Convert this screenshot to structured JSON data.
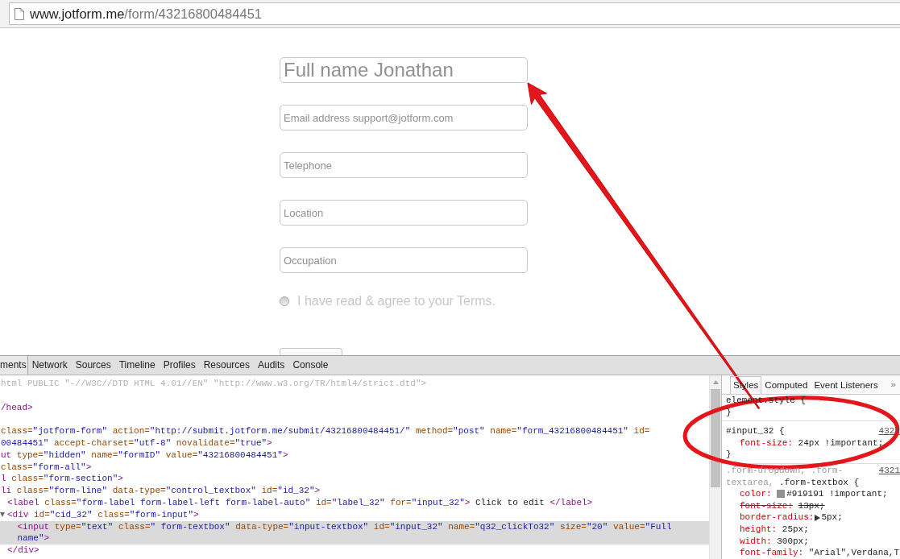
{
  "address_bar": {
    "host": "www.jotform.me",
    "path": "/form/43216800484451"
  },
  "form": {
    "fields": [
      {
        "kind": "large",
        "value": "Full name Jonathan"
      },
      {
        "kind": "normal",
        "value": "Email address support@jotform.com"
      },
      {
        "kind": "normal",
        "value": "Telephone"
      },
      {
        "kind": "normal",
        "value": "Location"
      },
      {
        "kind": "normal",
        "value": "Occupation"
      }
    ],
    "terms": {
      "label": "I have read & agree to your Terms.",
      "checked": false
    }
  },
  "devtools": {
    "tabs": [
      {
        "label": "ments",
        "selected": true
      },
      {
        "label": "Network",
        "selected": false
      },
      {
        "label": "Sources",
        "selected": false
      },
      {
        "label": "Timeline",
        "selected": false
      },
      {
        "label": "Profiles",
        "selected": false
      },
      {
        "label": "Resources",
        "selected": false
      },
      {
        "label": "Audits",
        "selected": false
      },
      {
        "label": "Console",
        "selected": false
      }
    ]
  },
  "elements": {
    "tree": [
      {
        "lines": [
          [
            {
              "kind": "doctype",
              "text": "html PUBLIC \"-//W3C//DTD HTML 4.01//EN\" \"http://www.w3.org/TR/html4/strict.dtd\">"
            }
          ]
        ],
        "selected": false
      },
      {
        "children": [
          {
            "lines": [
              [
                {
                  "kind": "tag",
                  "text": "/head>"
                }
              ]
            ],
            "selected": false
          },
          {
            "children": [
              {
                "lines": [
                  [
                    {
                      "kind": "attr",
                      "text": "class="
                    },
                    {
                      "kind": "value",
                      "text": "\"jotform-form\""
                    },
                    {
                      "kind": "attr",
                      "text": " action="
                    },
                    {
                      "kind": "value",
                      "text": "\"http://submit.jotform.me/submit/43216800484451/\""
                    },
                    {
                      "kind": "attr",
                      "text": " method="
                    },
                    {
                      "kind": "value",
                      "text": "\"post\""
                    },
                    {
                      "kind": "attr",
                      "text": " name="
                    },
                    {
                      "kind": "value",
                      "text": "\"form_43216800484451\""
                    },
                    {
                      "kind": "attr",
                      "text": " id="
                    }
                  ],
                  [
                    {
                      "kind": "value",
                      "text": "00484451\""
                    },
                    {
                      "kind": "attr",
                      "text": " accept-charset="
                    },
                    {
                      "kind": "value",
                      "text": "\"utf-8\""
                    },
                    {
                      "kind": "attr",
                      "text": " novalidate="
                    },
                    {
                      "kind": "value",
                      "text": "\"true\""
                    },
                    {
                      "kind": "tag",
                      "text": ">"
                    }
                  ]
                ],
                "selected": false,
                "children": [
                  {
                    "lines": [
                      [
                        {
                          "kind": "tag",
                          "text": "ut"
                        },
                        {
                          "kind": "attr",
                          "text": " type="
                        },
                        {
                          "kind": "value",
                          "text": "\"hidden\""
                        },
                        {
                          "kind": "attr",
                          "text": " name="
                        },
                        {
                          "kind": "value",
                          "text": "\"formID\""
                        },
                        {
                          "kind": "attr",
                          "text": " value="
                        },
                        {
                          "kind": "value",
                          "text": "\"43216800484451\""
                        },
                        {
                          "kind": "tag",
                          "text": ">"
                        }
                      ]
                    ],
                    "selected": false
                  },
                  {
                    "lines": [
                      [
                        {
                          "kind": "attr",
                          "text": "class="
                        },
                        {
                          "kind": "value",
                          "text": "\"form-all\""
                        },
                        {
                          "kind": "tag",
                          "text": ">"
                        }
                      ]
                    ],
                    "selected": false,
                    "children": [
                      {
                        "lines": [
                          [
                            {
                              "kind": "tag",
                              "text": "l"
                            },
                            {
                              "kind": "attr",
                              "text": " class="
                            },
                            {
                              "kind": "value",
                              "text": "\"form-section\""
                            },
                            {
                              "kind": "tag",
                              "text": ">"
                            }
                          ]
                        ],
                        "selected": false,
                        "children": [
                          {
                            "lines": [
                              [
                                {
                                  "kind": "tag",
                                  "text": "li"
                                },
                                {
                                  "kind": "attr",
                                  "text": " class="
                                },
                                {
                                  "kind": "value",
                                  "text": "\"form-line\""
                                },
                                {
                                  "kind": "attr",
                                  "text": " data-type="
                                },
                                {
                                  "kind": "value",
                                  "text": "\"control_textbox\""
                                },
                                {
                                  "kind": "attr",
                                  "text": " id="
                                },
                                {
                                  "kind": "value",
                                  "text": "\"id_32\""
                                },
                                {
                                  "kind": "tag",
                                  "text": ">"
                                }
                              ]
                            ],
                            "selected": false,
                            "children": [
                              {
                                "lines": [
                                  [
                                    {
                                      "kind": "tag",
                                      "text": "<label"
                                    },
                                    {
                                      "kind": "attr",
                                      "text": " class="
                                    },
                                    {
                                      "kind": "value",
                                      "text": "\"form-label form-label-left form-label-auto\""
                                    },
                                    {
                                      "kind": "attr",
                                      "text": " id="
                                    },
                                    {
                                      "kind": "value",
                                      "text": "\"label_32\""
                                    },
                                    {
                                      "kind": "attr",
                                      "text": " for="
                                    },
                                    {
                                      "kind": "value",
                                      "text": "\"input_32\""
                                    },
                                    {
                                      "kind": "tag",
                                      "text": ">"
                                    },
                                    {
                                      "kind": "text",
                                      "text": " Click to edit "
                                    },
                                    {
                                      "kind": "tag",
                                      "text": "</label>"
                                    }
                                  ]
                                ],
                                "selected": false
                              },
                              {
                                "lines": [
                                  [
                                    {
                                      "kind": "tag",
                                      "text": "<div"
                                    },
                                    {
                                      "kind": "attr",
                                      "text": " id="
                                    },
                                    {
                                      "kind": "value",
                                      "text": "\"cid_32\""
                                    },
                                    {
                                      "kind": "attr",
                                      "text": " class="
                                    },
                                    {
                                      "kind": "value",
                                      "text": "\"form-input\""
                                    },
                                    {
                                      "kind": "tag",
                                      "text": ">"
                                    }
                                  ]
                                ],
                                "selected": false,
                                "expanded": true,
                                "children": [
                                  {
                                    "lines": [
                                      [
                                        {
                                          "kind": "tag",
                                          "text": "<input"
                                        },
                                        {
                                          "kind": "attr",
                                          "text": " type="
                                        },
                                        {
                                          "kind": "value",
                                          "text": "\"text\""
                                        },
                                        {
                                          "kind": "attr",
                                          "text": " class="
                                        },
                                        {
                                          "kind": "value",
                                          "text": "\" form-textbox\""
                                        },
                                        {
                                          "kind": "attr",
                                          "text": " data-type="
                                        },
                                        {
                                          "kind": "value",
                                          "text": "\"input-textbox\""
                                        },
                                        {
                                          "kind": "attr",
                                          "text": " id="
                                        },
                                        {
                                          "kind": "value",
                                          "text": "\"input_32\""
                                        },
                                        {
                                          "kind": "attr",
                                          "text": " name="
                                        },
                                        {
                                          "kind": "value",
                                          "text": "\"q32_clickTo32\""
                                        },
                                        {
                                          "kind": "attr",
                                          "text": " size="
                                        },
                                        {
                                          "kind": "value",
                                          "text": "\"20\""
                                        },
                                        {
                                          "kind": "attr",
                                          "text": " value="
                                        },
                                        {
                                          "kind": "value",
                                          "text": "\"Full"
                                        }
                                      ],
                                      [
                                        {
                                          "kind": "value",
                                          "text": "name\""
                                        },
                                        {
                                          "kind": "tag",
                                          "text": ">"
                                        }
                                      ]
                                    ],
                                    "selected": true
                                  }
                                ],
                                "close": [
                                  {
                                    "kind": "tag",
                                    "text": "</div>"
                                  }
                                ]
                              }
                            ]
                          }
                        ]
                      }
                    ]
                  }
                ]
              }
            ]
          }
        ]
      }
    ]
  },
  "styles_pane": {
    "tabs": [
      {
        "label": "Styles",
        "selected": true
      },
      {
        "label": "Computed",
        "selected": false
      },
      {
        "label": "Event Listeners",
        "selected": false
      }
    ],
    "more": "»",
    "rules": [
      {
        "selector_lines": [
          [
            {
              "text": "element.style {",
              "matched": true
            }
          ]
        ],
        "close": "}"
      },
      {
        "selector_lines": [
          [
            {
              "text": "#input_32 {",
              "matched": true
            }
          ]
        ],
        "source": "4321",
        "declarations": [
          {
            "property": "font-size:",
            "value": "24px !important;",
            "overridden": false
          }
        ],
        "close": "}"
      },
      {
        "selector_lines": [
          [
            {
              "text": ".form-dropdown, .form-",
              "matched": false
            }
          ],
          [
            {
              "text": "textarea, ",
              "matched": false
            },
            {
              "text": ".form-textbox {",
              "matched": true
            }
          ]
        ],
        "source": "4321",
        "declarations": [
          {
            "property": "color:",
            "color": "#919191",
            "value": "#919191 !important;",
            "overridden": false
          },
          {
            "property": "font-size:",
            "value": "13px;",
            "overridden": true
          },
          {
            "property": "border-radius:",
            "expanded": false,
            "value": "5px;",
            "overridden": false
          },
          {
            "property": "height:",
            "value": "25px;",
            "overridden": false
          },
          {
            "property": "width:",
            "value": "300px;",
            "overridden": false
          },
          {
            "property": "font-family:",
            "value": "\"Arial\",Verdana,T",
            "overridden": false
          }
        ]
      }
    ]
  }
}
